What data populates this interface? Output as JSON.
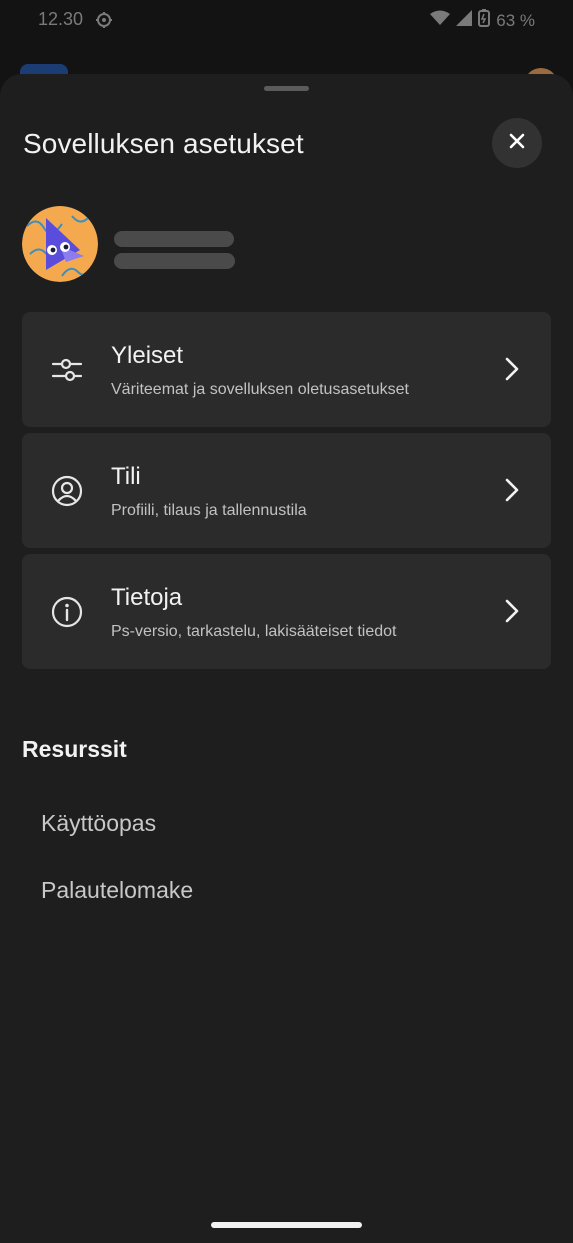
{
  "status_bar": {
    "time": "12.30",
    "battery": "63 %"
  },
  "sheet": {
    "title": "Sovelluksen asetukset",
    "close_icon": "close-icon"
  },
  "settings": [
    {
      "title": "Yleiset",
      "subtitle": "Väriteemat ja sovelluksen oletusasetukset",
      "icon": "sliders-icon"
    },
    {
      "title": "Tili",
      "subtitle": "Profiili, tilaus ja tallennustila",
      "icon": "account-icon"
    },
    {
      "title": "Tietoja",
      "subtitle": "Ps-versio, tarkastelu, lakisääteiset tiedot",
      "icon": "info-icon"
    }
  ],
  "resources": {
    "title": "Resurssit",
    "links": [
      "Käyttöopas",
      "Palautelomake"
    ]
  },
  "colors": {
    "sheet_background": "#1e1e1e",
    "card_background": "#2b2b2b",
    "text_primary": "#f2f2f2",
    "text_secondary": "#c2c2c2"
  }
}
